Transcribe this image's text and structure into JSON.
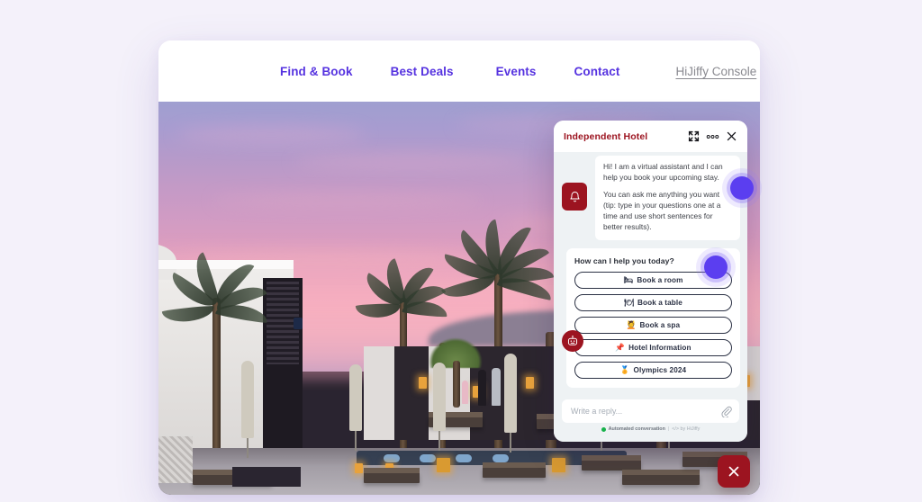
{
  "site": {
    "nav": {
      "links": [
        {
          "label": "Find & Book"
        },
        {
          "label": "Best Deals"
        },
        {
          "label": "Events"
        },
        {
          "label": "Contact"
        }
      ],
      "console_link": "HiJiffy Console",
      "link_color": "#5633e0",
      "console_color": "#8a8a90"
    },
    "hero": {
      "alt": "resort-pool-terrace-at-sunset-with-palm-trees"
    }
  },
  "chat_widget": {
    "title": "Independent Hotel",
    "title_color": "#9c1420",
    "header_icons": [
      {
        "name": "expand-icon"
      },
      {
        "name": "more-options-icon"
      },
      {
        "name": "close-icon"
      }
    ],
    "messages": [
      {
        "from": "bot",
        "text": "Hi! I am a virtual assistant and I can help you book your upcoming stay."
      },
      {
        "from": "bot",
        "text": "You can ask me anything you want (tip: type in your questions one at a time and use short sentences for better results)."
      }
    ],
    "notification_button": {
      "name": "bell-icon",
      "color": "#9c1420"
    },
    "bot_avatar_button": {
      "name": "robot-icon",
      "color": "#9c1420"
    },
    "quick_replies": {
      "prompt": "How can I help you today?",
      "options": [
        {
          "emoji": "🛏",
          "label": "Book a room"
        },
        {
          "emoji": "🍽",
          "label": "Book a table"
        },
        {
          "emoji": "💆",
          "label": "Book a spa"
        },
        {
          "emoji": "📌",
          "label": "Hotel Information"
        },
        {
          "emoji": "🏅",
          "label": "Olympics 2024"
        }
      ]
    },
    "reply": {
      "placeholder": "Write a reply...",
      "value": "",
      "attachment_icon": "paperclip-icon"
    },
    "footer": {
      "status_text": "Automated conversation",
      "separator": "|",
      "credit": "</> by HiJiffy",
      "status_color": "#18b24b"
    }
  },
  "overlays": {
    "cursor_color": "#5b3ef0",
    "cursors": [
      {
        "name": "cursor-indicator-message"
      },
      {
        "name": "cursor-indicator-book-a-room"
      }
    ],
    "close_fab": {
      "name": "close-widget-icon",
      "color": "#9c1420"
    }
  }
}
